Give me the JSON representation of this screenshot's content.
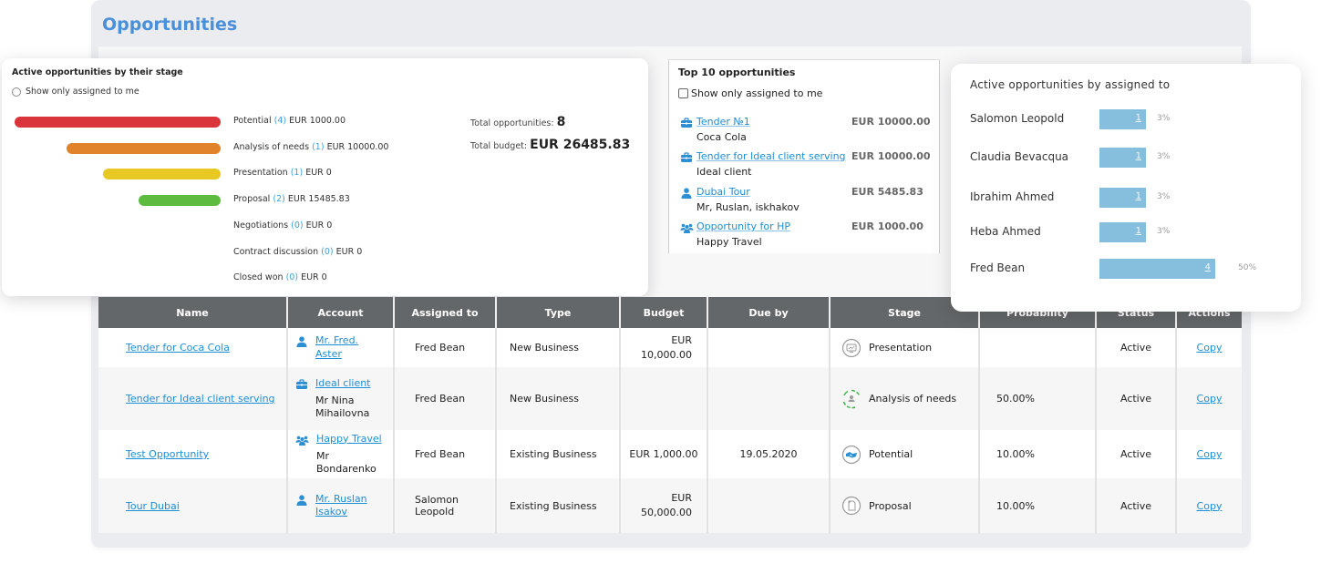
{
  "page": {
    "title": "Opportunities"
  },
  "stage_widget": {
    "title": "Active opportunities by their stage",
    "filter_label": "Show only assigned to me",
    "stages": [
      {
        "name": "Potential",
        "count": "(4)",
        "amount": "EUR 1000.00",
        "color": "#d9353a",
        "has_bar": true,
        "bar_fraction": 1.0
      },
      {
        "name": "Analysis of needs",
        "count": "(1)",
        "amount": "EUR 10000.00",
        "color": "#e1832b",
        "has_bar": true,
        "bar_fraction": 0.75
      },
      {
        "name": "Presentation",
        "count": "(1)",
        "amount": "EUR 0",
        "color": "#e8c823",
        "has_bar": true,
        "bar_fraction": 0.57
      },
      {
        "name": "Proposal",
        "count": "(2)",
        "amount": "EUR 15485.83",
        "color": "#5dbb3f",
        "has_bar": true,
        "bar_fraction": 0.4
      },
      {
        "name": "Negotiations",
        "count": "(0)",
        "amount": "EUR 0",
        "color": "",
        "has_bar": false,
        "bar_fraction": 0
      },
      {
        "name": "Contract discussion",
        "count": "(0)",
        "amount": "EUR 0",
        "color": "",
        "has_bar": false,
        "bar_fraction": 0
      },
      {
        "name": "Closed won",
        "count": "(0)",
        "amount": "EUR 0",
        "color": "",
        "has_bar": false,
        "bar_fraction": 0
      }
    ],
    "totals": {
      "opportunities_label": "Total opportunities:",
      "opportunities_value": "8",
      "budget_label": "Total budget:",
      "budget_value": "EUR 26485.83"
    }
  },
  "top10_widget": {
    "title": "Top 10 opportunities",
    "filter_label": "Show only assigned to me",
    "items": [
      {
        "icon": "briefcase-icon",
        "name": "Tender №1",
        "account": "Coca Cola",
        "amount": "EUR 10000.00"
      },
      {
        "icon": "briefcase-icon",
        "name": "Tender for Ideal client serving",
        "account": "Ideal client",
        "amount": "EUR 10000.00"
      },
      {
        "icon": "person-icon",
        "name": "Dubai Tour",
        "account": "Mr, Ruslan, iskhakov",
        "amount": "EUR 5485.83"
      },
      {
        "icon": "group-icon",
        "name": "Opportunity for HP",
        "account": "Happy Travel",
        "amount": "EUR 1000.00"
      }
    ]
  },
  "assigned_widget": {
    "title": "Active opportunities by assigned to",
    "rows": [
      {
        "name": "Salomon Leopold",
        "count": "1",
        "percent": "3%",
        "value": 1
      },
      {
        "name": "Claudia Bevacqua",
        "count": "1",
        "percent": "3%",
        "value": 1
      },
      {
        "name": "Ibrahim Ahmed",
        "count": "1",
        "percent": "3%",
        "value": 1
      },
      {
        "name": "Heba Ahmed",
        "count": "1",
        "percent": "3%",
        "value": 1
      },
      {
        "name": "Fred Bean",
        "count": "4",
        "percent": "50%",
        "value": 4
      }
    ],
    "bar_color": "#86bfde"
  },
  "table": {
    "columns": [
      "Name",
      "Account",
      "Assigned to",
      "Type",
      "Budget",
      "Due by",
      "Stage",
      "Probability",
      "Status",
      "Actions"
    ],
    "rows": [
      {
        "name": "Tender for Coca Cola",
        "account_icon": "person-icon",
        "account_link": "Mr. Fred. Aster",
        "account_contact": "",
        "assigned_to": "Fred Bean",
        "type": "New Business",
        "budget_line1": "EUR",
        "budget_line2": "10,000.00",
        "due_by": "",
        "stage": "Presentation",
        "stage_icon": "presentation-icon",
        "probability": "",
        "status": "Active",
        "action": "Copy"
      },
      {
        "name": "Tender for Ideal client serving",
        "account_icon": "briefcase-icon",
        "account_link": "Ideal client",
        "account_contact": "Mr Nina Mihailovna",
        "assigned_to": "Fred Bean",
        "type": "New Business",
        "budget_line1": "",
        "budget_line2": "",
        "due_by": "",
        "stage": "Analysis of needs",
        "stage_icon": "analysis-icon",
        "probability": "50.00%",
        "status": "Active",
        "action": "Copy"
      },
      {
        "name": "Test Opportunity",
        "account_icon": "group-icon",
        "account_link": "Happy Travel",
        "account_contact": "Mr Bondarenko",
        "assigned_to": "Fred Bean",
        "type": "Existing Business",
        "budget_line1": "EUR 1,000.00",
        "budget_line2": "",
        "due_by": "19.05.2020",
        "stage": "Potential",
        "stage_icon": "handshake-icon",
        "probability": "10.00%",
        "status": "Active",
        "action": "Copy"
      },
      {
        "name": "Tour Dubai",
        "account_icon": "person-icon",
        "account_link": "Mr. Ruslan Isakov",
        "account_contact": "",
        "assigned_to": "Salomon Leopold",
        "type": "Existing Business",
        "budget_line1": "EUR",
        "budget_line2": "50,000.00",
        "due_by": "",
        "stage": "Proposal",
        "stage_icon": "document-icon",
        "probability": "10.00%",
        "status": "Active",
        "action": "Copy"
      }
    ]
  },
  "colors": {
    "accent": "#4a90d9",
    "link": "#1b8fd6",
    "table_header": "#646769"
  }
}
